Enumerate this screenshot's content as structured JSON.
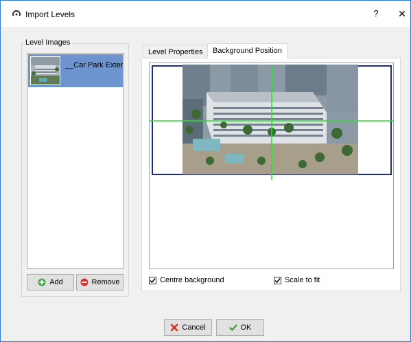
{
  "window": {
    "title": "Import Levels",
    "help_label": "?",
    "close_label": "✕"
  },
  "level_images": {
    "group_title": "Level Images",
    "items": [
      {
        "label": "__Car Park Exterior"
      }
    ],
    "add_label": "Add",
    "remove_label": "Remove"
  },
  "tabs": [
    {
      "label": "Level Properties",
      "active": false
    },
    {
      "label": "Background Position",
      "active": true
    }
  ],
  "options": {
    "centre_background": {
      "label": "Centre background",
      "checked": true
    },
    "scale_to_fit": {
      "label": "Scale to fit",
      "checked": true
    }
  },
  "footer": {
    "cancel_label": "Cancel",
    "ok_label": "OK"
  },
  "colors": {
    "selection": "#6e94d0",
    "frame": "#1e2a8e",
    "crosshair": "#27e32b",
    "add_icon": "#3aa33a",
    "remove_icon": "#d9302c"
  }
}
